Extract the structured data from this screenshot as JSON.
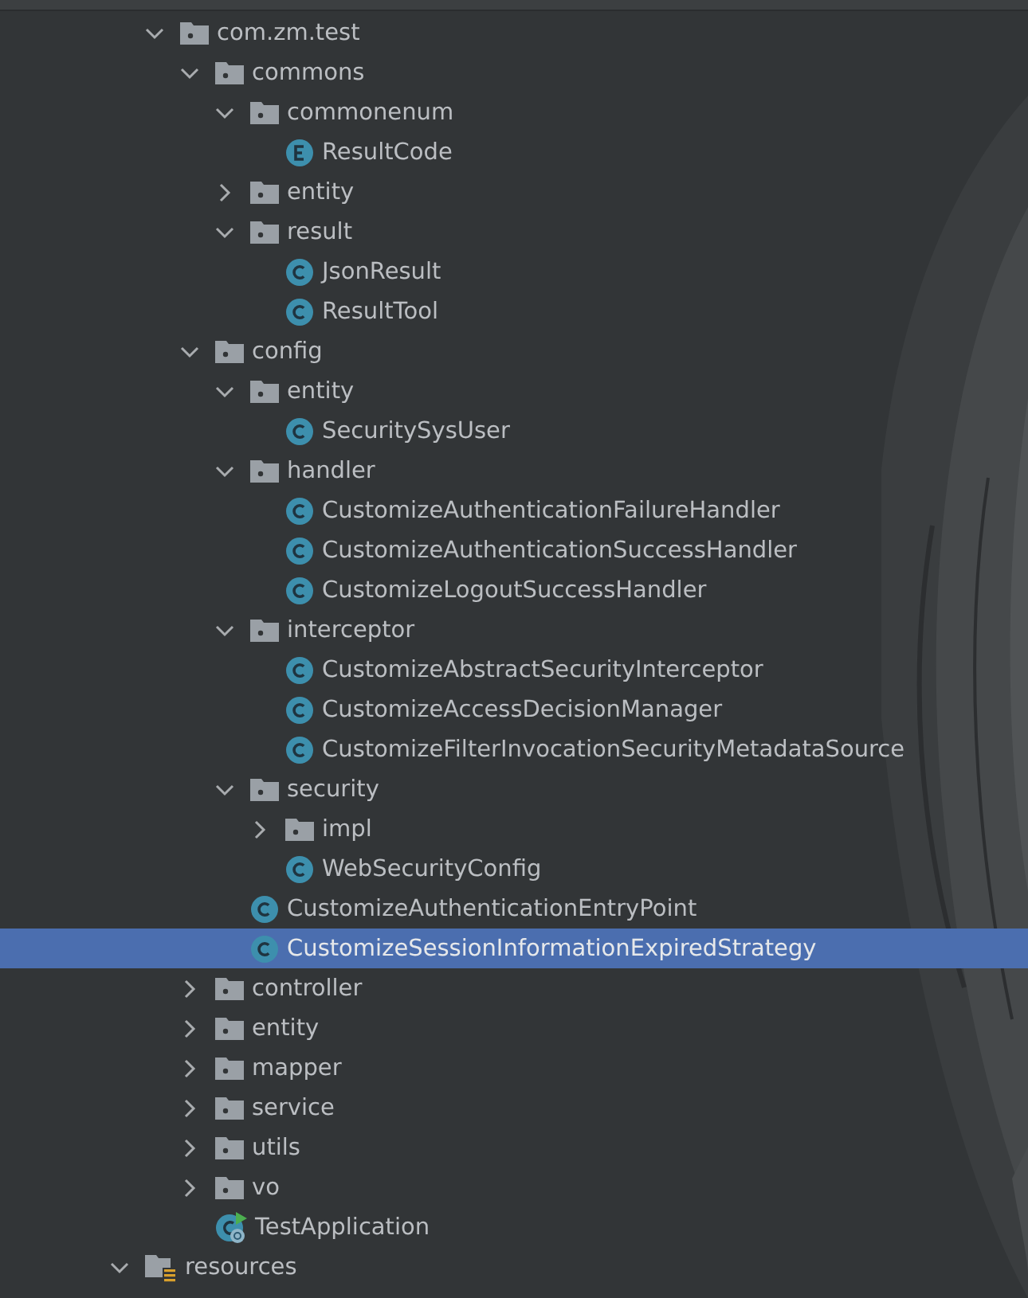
{
  "tree": [
    {
      "kind": "package",
      "label": "com.zm.test",
      "expanded": true,
      "selected": false,
      "children": [
        {
          "kind": "package",
          "label": "commons",
          "expanded": true,
          "selected": false,
          "children": [
            {
              "kind": "package",
              "label": "commonenum",
              "expanded": true,
              "selected": false,
              "children": [
                {
                  "kind": "enum",
                  "label": "ResultCode",
                  "selected": false
                }
              ]
            },
            {
              "kind": "package",
              "label": "entity",
              "expanded": false,
              "selected": false
            },
            {
              "kind": "package",
              "label": "result",
              "expanded": true,
              "selected": false,
              "children": [
                {
                  "kind": "class",
                  "label": "JsonResult",
                  "selected": false
                },
                {
                  "kind": "class",
                  "label": "ResultTool",
                  "selected": false
                }
              ]
            }
          ]
        },
        {
          "kind": "package",
          "label": "config",
          "expanded": true,
          "selected": false,
          "children": [
            {
              "kind": "package",
              "label": "entity",
              "expanded": true,
              "selected": false,
              "children": [
                {
                  "kind": "class",
                  "label": "SecuritySysUser",
                  "selected": false
                }
              ]
            },
            {
              "kind": "package",
              "label": "handler",
              "expanded": true,
              "selected": false,
              "children": [
                {
                  "kind": "class",
                  "label": "CustomizeAuthenticationFailureHandler",
                  "selected": false
                },
                {
                  "kind": "class",
                  "label": "CustomizeAuthenticationSuccessHandler",
                  "selected": false
                },
                {
                  "kind": "class",
                  "label": "CustomizeLogoutSuccessHandler",
                  "selected": false
                }
              ]
            },
            {
              "kind": "package",
              "label": "interceptor",
              "expanded": true,
              "selected": false,
              "children": [
                {
                  "kind": "class",
                  "label": "CustomizeAbstractSecurityInterceptor",
                  "selected": false
                },
                {
                  "kind": "class",
                  "label": "CustomizeAccessDecisionManager",
                  "selected": false
                },
                {
                  "kind": "class",
                  "label": "CustomizeFilterInvocationSecurityMetadataSource",
                  "selected": false
                }
              ]
            },
            {
              "kind": "package",
              "label": "security",
              "expanded": true,
              "selected": false,
              "children": [
                {
                  "kind": "package",
                  "label": "impl",
                  "expanded": false,
                  "selected": false
                },
                {
                  "kind": "class",
                  "label": "WebSecurityConfig",
                  "selected": false
                }
              ]
            },
            {
              "kind": "class",
              "label": "CustomizeAuthenticationEntryPoint",
              "selected": false
            },
            {
              "kind": "class",
              "label": "CustomizeSessionInformationExpiredStrategy",
              "selected": true
            }
          ]
        },
        {
          "kind": "package",
          "label": "controller",
          "expanded": false,
          "selected": false
        },
        {
          "kind": "package",
          "label": "entity",
          "expanded": false,
          "selected": false
        },
        {
          "kind": "package",
          "label": "mapper",
          "expanded": false,
          "selected": false
        },
        {
          "kind": "package",
          "label": "service",
          "expanded": false,
          "selected": false
        },
        {
          "kind": "package",
          "label": "utils",
          "expanded": false,
          "selected": false
        },
        {
          "kind": "package",
          "label": "vo",
          "expanded": false,
          "selected": false
        },
        {
          "kind": "app",
          "label": "TestApplication",
          "selected": false
        }
      ]
    },
    {
      "kind": "resources",
      "label": "resources",
      "expanded": true,
      "selected": false
    }
  ]
}
